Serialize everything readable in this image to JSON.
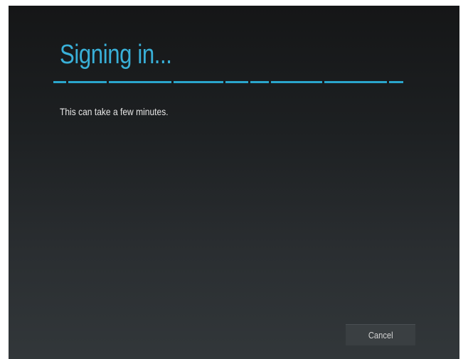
{
  "dialog": {
    "title": "Signing in...",
    "message": "This can take a few minutes.",
    "cancel_label": "Cancel"
  },
  "progress": {
    "indeterminate": true,
    "color": "#2aa6cc"
  },
  "colors": {
    "title": "#39b0d8",
    "background_top": "#151617",
    "background_bottom": "#32373a"
  }
}
